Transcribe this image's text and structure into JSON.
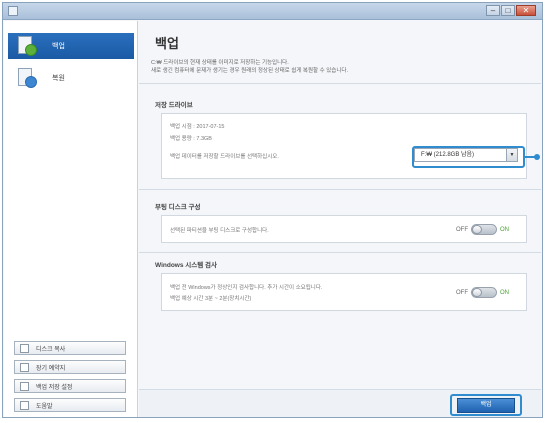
{
  "window": {
    "controls": {
      "minimize": "–",
      "maximize": "□",
      "close": "✕"
    }
  },
  "sidebar": {
    "items": [
      {
        "label": "백업",
        "icon": "backup-doc-icon",
        "selected": true
      },
      {
        "label": "복원",
        "icon": "restore-doc-icon",
        "selected": false
      }
    ],
    "buttons": [
      {
        "label": "디스크 복사",
        "icon": "disk-copy-icon"
      },
      {
        "label": "장기 예약지",
        "icon": "schedule-icon"
      },
      {
        "label": "백업 저장 설정",
        "icon": "settings-icon"
      },
      {
        "label": "도움말",
        "icon": "help-icon"
      }
    ]
  },
  "main": {
    "title": "백업",
    "description_line1": "C:₩ 드라이브의 현재 상태를 이미지로 저장하는 기능입니다.",
    "description_line2": "새로 생긴 컴퓨터에 문제가 생기는 경우 원래의 정상된 상태로 쉽게 복원할 수 있습니다.",
    "target_section": {
      "title": "저장 드라이브",
      "backup_time_label": "백업 시점 : 2017-07-15",
      "backup_size_label": "백업 용량 : 7.3GB",
      "prompt": "백업 데이터를 저장할 드라이브를 선택하십시오.",
      "selected_drive": "F:₩ (212.8GB 남음)"
    },
    "partition_section": {
      "title": "부팅 디스크 구성",
      "text": "선택된 파티션을 부팅 디스크로 구성합니다.",
      "toggle_off": "OFF",
      "toggle_on": "ON"
    },
    "windows_section": {
      "title": "Windows 시스템 검사",
      "text_line1": "백업 전 Windows가 정상인지 검사합니다. 추가 시간이 소요됩니다.",
      "text_line2": "백업 예상 시간 3분 ~ 2분(장치시간)",
      "toggle_off": "OFF",
      "toggle_on": "ON"
    },
    "backup_button": "백업"
  },
  "colors": {
    "accent": "#2e8ccf",
    "sidebar_selected": "#1b5aa5",
    "toggle_on": "#4aa02f"
  }
}
